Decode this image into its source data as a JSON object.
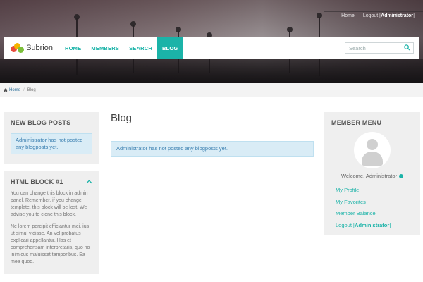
{
  "header": {
    "top_links": {
      "home": "Home",
      "logout_prefix": "Logout [",
      "logout_user": "Administrator",
      "logout_suffix": "]"
    },
    "brand": {
      "name": "Subrion"
    },
    "nav": [
      {
        "label": "HOME",
        "active": false
      },
      {
        "label": "MEMBERS",
        "active": false
      },
      {
        "label": "SEARCH",
        "active": false
      },
      {
        "label": "BLOG",
        "active": true
      }
    ],
    "search": {
      "placeholder": "Search",
      "icon": "search-icon"
    },
    "colors": {
      "accent": "#1bb3a8",
      "alert_bg": "#d9ecf6",
      "alert_text": "#3a7fb0"
    }
  },
  "breadcrumb": {
    "home": "Home",
    "current": "Blog"
  },
  "left": {
    "new_posts": {
      "title": "NEW BLOG POSTS",
      "message": "Administrator has not posted any blogposts yet."
    },
    "html_block": {
      "title": "HTML BLOCK #1",
      "para1": "You can change this block in admin panel. Remember, if you change template, this block will be lost. We advise you to clone this block.",
      "para2": "Ne lorem percipit efficiantur mei, ius ut simul vidisse. An vel probatus explicari appellantur. Has et comprehensam interpretaris, quo no inimicus maluisset temporibus. Ea mea quod."
    }
  },
  "main": {
    "title": "Blog",
    "message": "Administrator has not posted any blogposts yet."
  },
  "right": {
    "title": "MEMBER MENU",
    "welcome": "Welcome, Administrator",
    "menu": {
      "profile": "My Profile",
      "favorites": "My Favorites",
      "balance": "Member Balance",
      "logout_prefix": "Logout [",
      "logout_user": "Administrator",
      "logout_suffix": "]"
    }
  }
}
